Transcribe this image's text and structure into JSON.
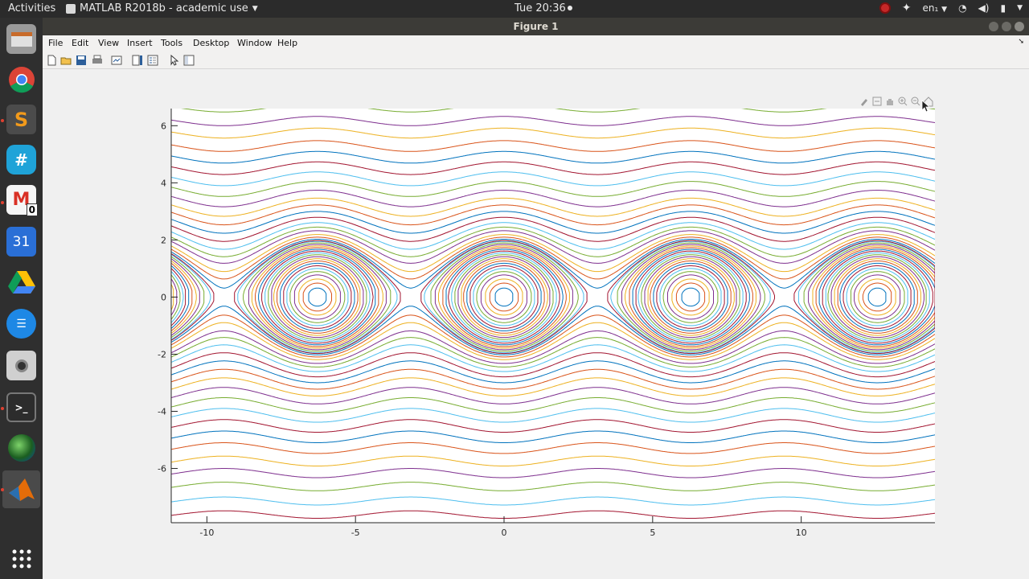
{
  "topbar": {
    "activities": "Activities",
    "app_name": "MATLAB R2018b - academic use",
    "clock": "Tue 20:36",
    "language": "en₁"
  },
  "window": {
    "title": "Figure 1"
  },
  "menu": {
    "items": [
      "File",
      "Edit",
      "View",
      "Insert",
      "Tools",
      "Desktop",
      "Window",
      "Help"
    ]
  },
  "toolbar": {
    "icons": [
      "new-figure-icon",
      "open-file-icon",
      "save-icon",
      "print-icon",
      "link-plot-icon",
      "insert-colorbar-icon",
      "insert-legend-icon",
      "edit-plot-icon",
      "property-inspector-icon"
    ]
  },
  "axes_toolbar": {
    "icons": [
      "brush-icon",
      "datatip-icon",
      "pan-icon",
      "zoom-in-icon",
      "zoom-out-icon",
      "home-icon"
    ]
  },
  "dock": {
    "apps": [
      "files-icon",
      "chrome-icon",
      "sublime-text-icon",
      "hangouts-icon",
      "gmail-icon",
      "calendar-icon",
      "google-drive-icon",
      "messages-icon",
      "camera-icon",
      "terminal-icon",
      "globe-icon",
      "matlab-icon",
      "show-apps-icon"
    ],
    "calendar_day": "31",
    "gmail_badge": "0"
  },
  "colors": {
    "series": [
      "#0072BD",
      "#D95319",
      "#EDB120",
      "#7E2F8E",
      "#77AC30",
      "#4DBEEE",
      "#A2142F"
    ]
  },
  "chart_data": {
    "type": "line",
    "description_source": "phase portrait of a pendulum: theta on x, omega on y; contour lines of E = 0.5*omega^2 - cos(theta)",
    "x_ticks": [
      "-10",
      "-5",
      "0",
      "5",
      "10"
    ],
    "y_ticks": [
      "6",
      "4",
      "2",
      "0",
      "-2",
      "-4",
      "-6"
    ],
    "xlim": [
      -11.2,
      14.5
    ],
    "ylim": [
      -7.9,
      6.6
    ],
    "energy_levels": [
      -0.95,
      -0.88,
      -0.8,
      -0.7,
      -0.6,
      -0.5,
      -0.4,
      -0.3,
      -0.2,
      -0.1,
      0.0,
      0.1,
      0.2,
      0.3,
      0.4,
      0.5,
      0.6,
      0.7,
      0.8,
      0.9,
      0.95,
      1.05,
      1.2,
      1.4,
      1.7,
      2.0,
      2.4,
      2.9,
      3.5,
      4.2,
      5.0,
      6.0,
      7.2,
      8.6,
      10.2,
      12.0,
      14.0,
      16.5,
      19.0,
      22.0,
      25.5,
      29.0
    ],
    "title": "",
    "xlabel": "",
    "ylabel": ""
  }
}
